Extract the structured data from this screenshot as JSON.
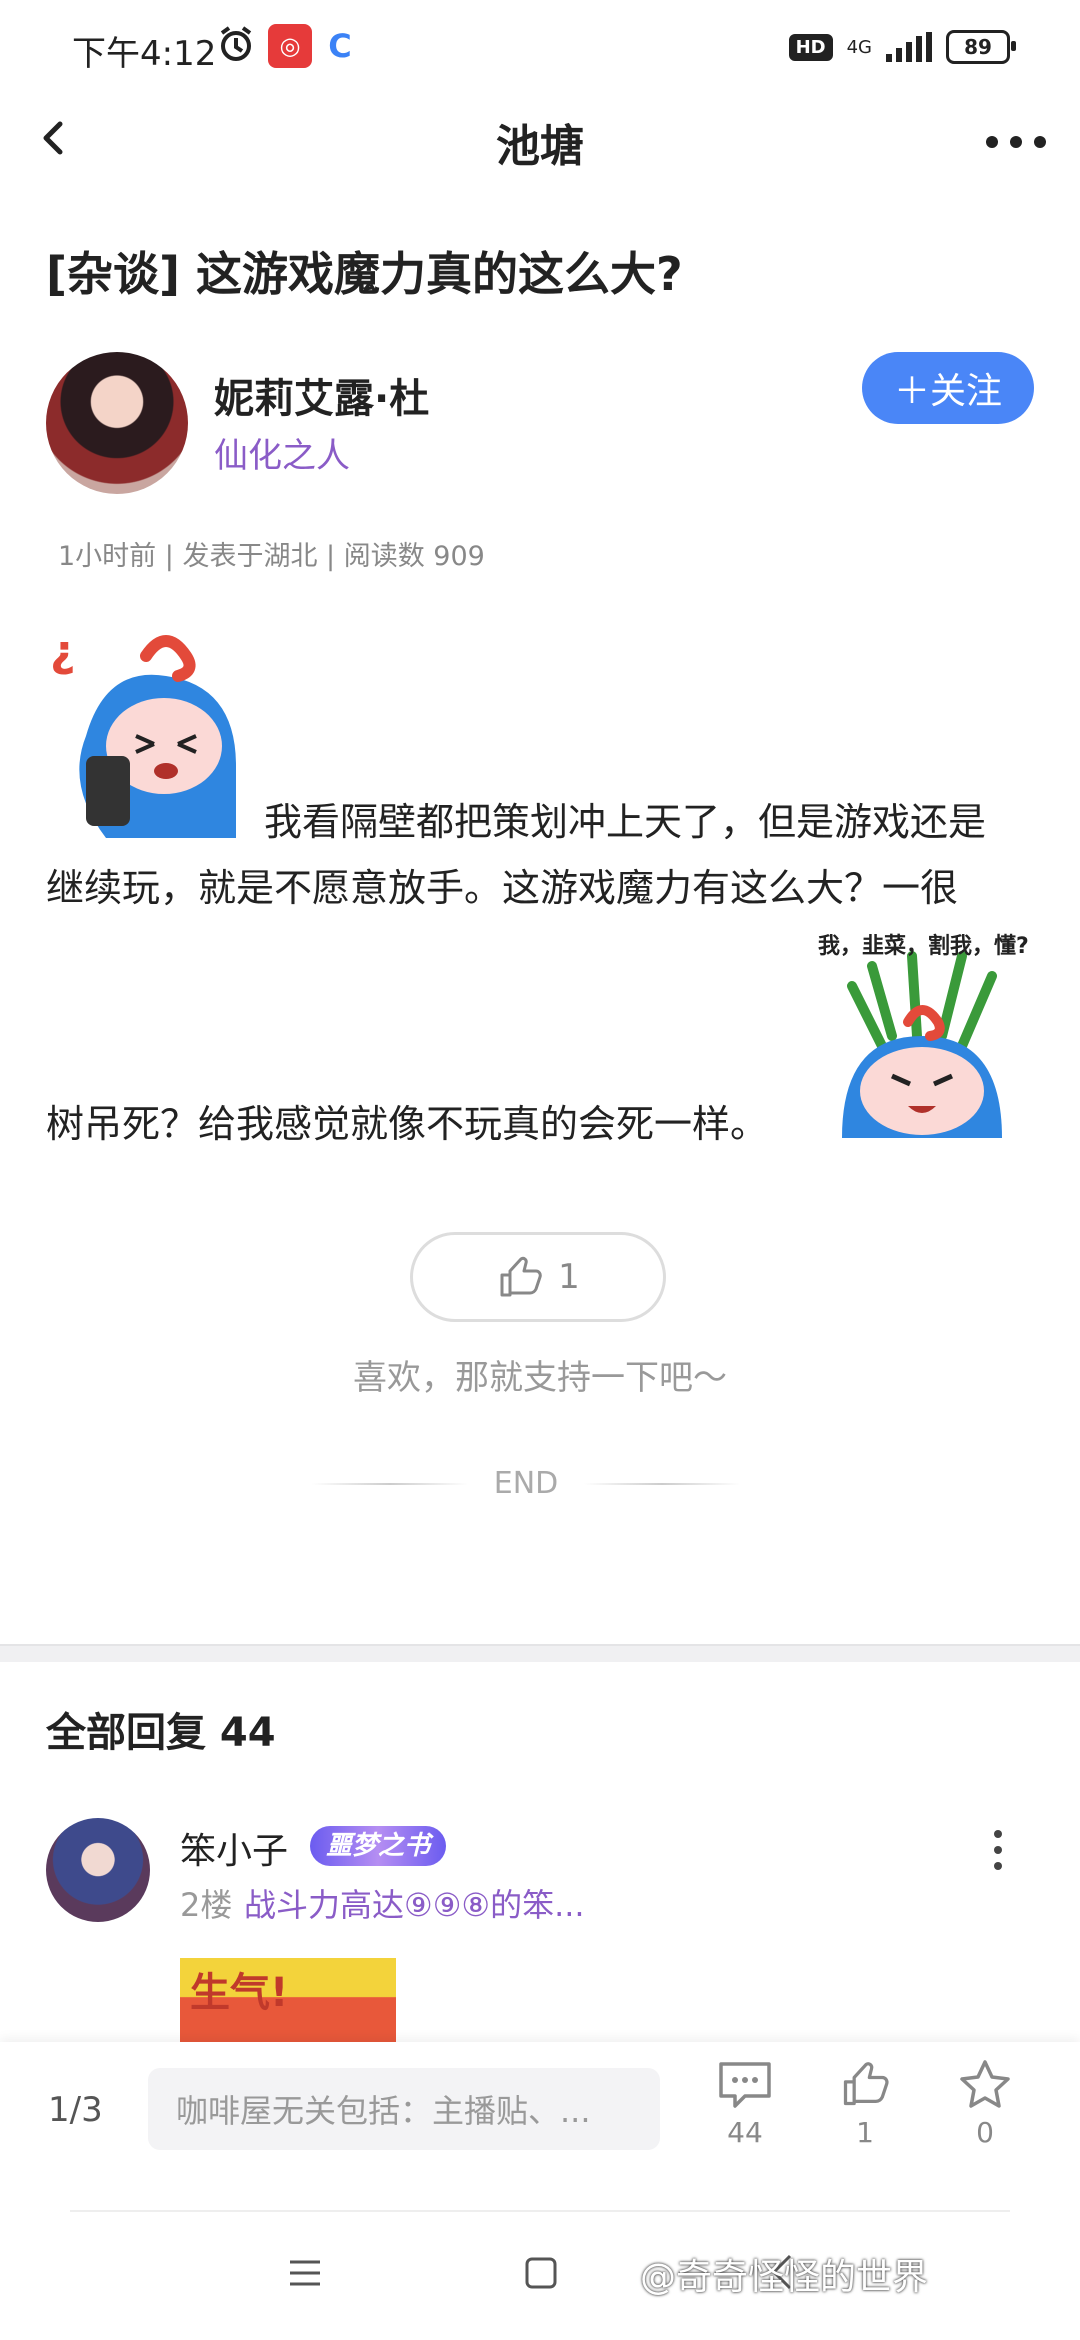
{
  "status_bar": {
    "time": "下午4:12",
    "network": "4G",
    "hd_label": "HD",
    "battery": "89"
  },
  "header": {
    "title": "池塘"
  },
  "post": {
    "title": "[杂谈] 这游戏魔力真的这么大?",
    "author": "妮莉艾露·杜",
    "author_tag": "仙化之人",
    "follow_label": "＋关注",
    "meta": "1小时前 | 发表于湖北 | 阅读数 909",
    "text_line1": "我看隔壁都把策划冲上天了，但是游戏还是",
    "text_line2": "继续玩，就是不愿意放手。这游戏魔力有这么大？一很",
    "text_line3": "树吊死？给我感觉就像不玩真的会死一样。",
    "sticker2_caption": "我，韭菜，割我，懂?",
    "like_count": "1",
    "support_text": "喜欢，那就支持一下吧～",
    "end_label": "END"
  },
  "replies": {
    "title": "全部回复  44",
    "items": [
      {
        "name": "笨小子",
        "badge": "噩梦之书",
        "floor": "2楼",
        "floor_text": "战斗力高达⑨⑨⑧的笨...",
        "image_text": "生气!"
      }
    ]
  },
  "bottom_bar": {
    "page_indicator": "1/3",
    "input_placeholder": "咖啡屋无关包括：主播贴、...",
    "comment_count": "44",
    "like_count": "1",
    "fav_count": "0"
  },
  "watermark": "@奇奇怪怪的世界",
  "colors": {
    "accent_blue": "#4a86f7",
    "purple_tag": "#8a5cc7"
  },
  "icons": [
    "back-icon",
    "more-icon",
    "thumb-up-icon",
    "comment-icon",
    "star-icon",
    "menu-nav-icon",
    "home-nav-icon",
    "back-nav-icon"
  ]
}
